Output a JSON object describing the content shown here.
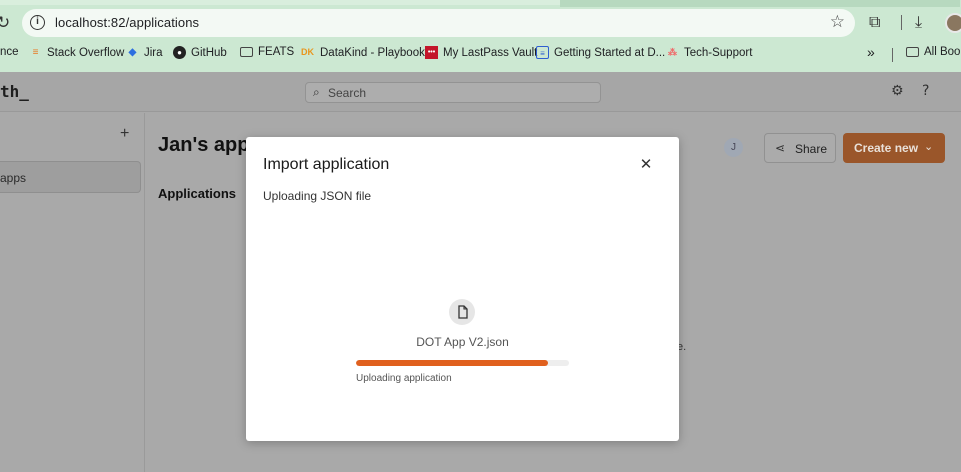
{
  "browser": {
    "url": "localhost:82/applications",
    "bookmarks": [
      {
        "label": "nce",
        "icon": "bookmark-icon"
      },
      {
        "label": "Stack Overflow",
        "icon": "stackoverflow-icon"
      },
      {
        "label": "Jira",
        "icon": "jira-icon"
      },
      {
        "label": "GitHub",
        "icon": "github-icon"
      },
      {
        "label": "FEATS",
        "icon": "folder-icon"
      },
      {
        "label": "DataKind - Playbook",
        "icon": "datakind-icon"
      },
      {
        "label": "My LastPass Vault",
        "icon": "lastpass-icon"
      },
      {
        "label": "Getting Started at D...",
        "icon": "document-icon"
      },
      {
        "label": "Tech-Support",
        "icon": "asana-icon"
      }
    ],
    "more_bookmarks": "»",
    "all_bookmarks": "All Book"
  },
  "app": {
    "logo": "th_",
    "search_placeholder": "Search",
    "sidebar_item": "apps",
    "heading": "Jan's apps",
    "tab": "Applications",
    "user_initial": "J",
    "share_label": "Share",
    "create_label": "Create new",
    "peek_text": "e."
  },
  "modal": {
    "title": "Import application",
    "subtitle": "Uploading JSON file",
    "filename": "DOT App V2.json",
    "progress": 0.9,
    "status": "Uploading application"
  },
  "colors": {
    "accent": "#e0601e",
    "chrome_bg": "#cce8d2"
  }
}
